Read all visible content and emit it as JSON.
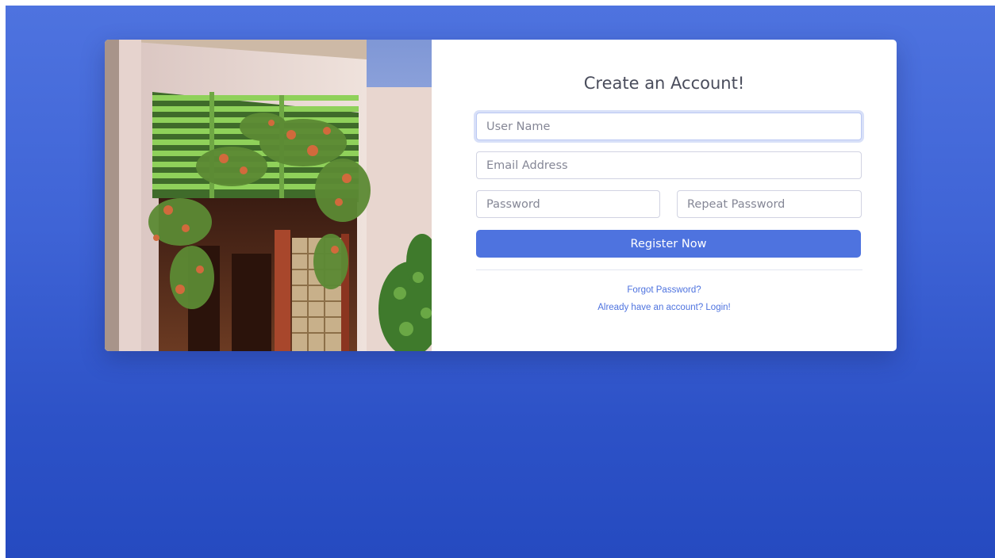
{
  "form": {
    "title": "Create an Account!",
    "username_placeholder": "User Name",
    "email_placeholder": "Email Address",
    "password_placeholder": "Password",
    "repeat_password_placeholder": "Repeat Password",
    "register_label": "Register Now",
    "forgot_password_label": "Forgot Password?",
    "login_link_label": "Already have an account? Login!"
  },
  "colors": {
    "primary": "#4e73df",
    "background_gradient_top": "#4e73df",
    "background_gradient_bottom": "#254ac0"
  }
}
